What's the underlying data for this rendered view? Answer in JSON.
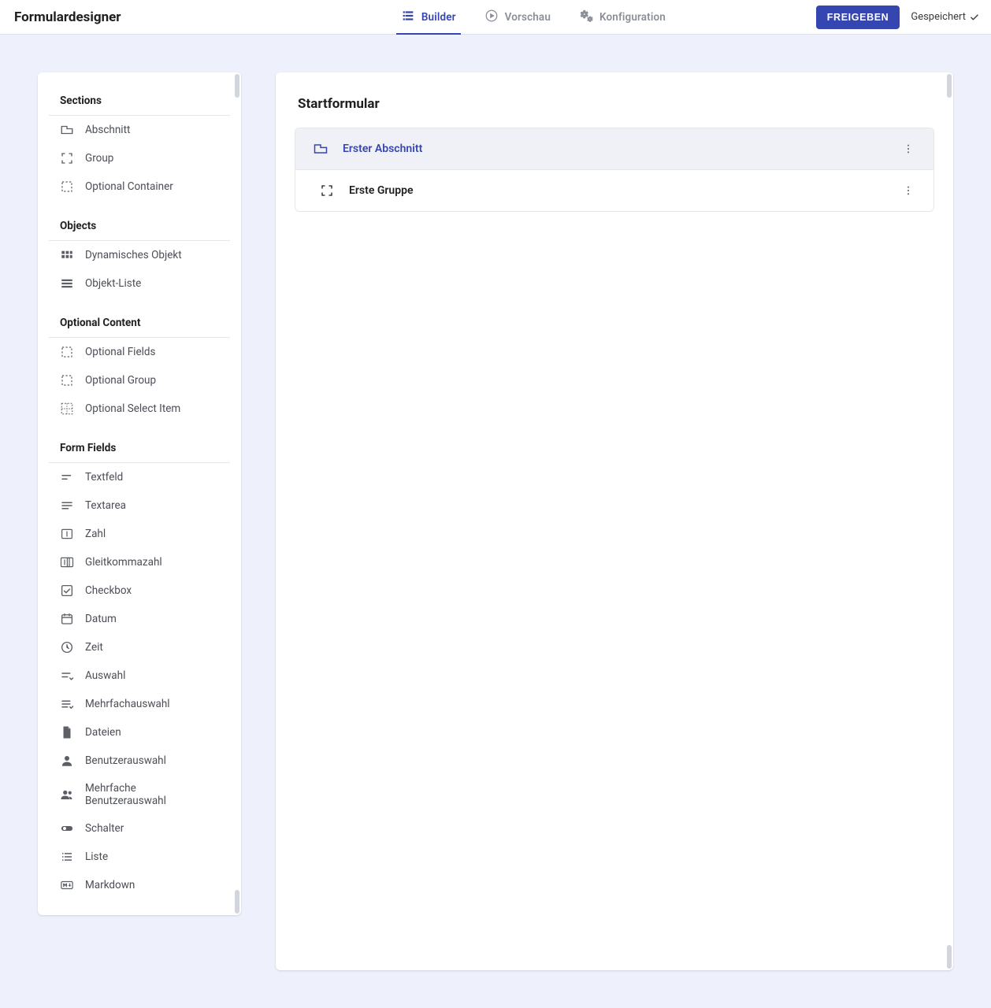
{
  "header": {
    "title": "Formulardesigner",
    "tabs": [
      {
        "id": "builder",
        "label": "Builder"
      },
      {
        "id": "vorschau",
        "label": "Vorschau"
      },
      {
        "id": "konfiguration",
        "label": "Konfiguration"
      }
    ],
    "active_tab": "builder",
    "publish_label": "FREIGEBEN",
    "saved_label": "Gespeichert"
  },
  "palette": {
    "sections": [
      {
        "title": "Sections",
        "items": [
          {
            "id": "abschnitt",
            "label": "Abschnitt",
            "icon": "tab-icon"
          },
          {
            "id": "group",
            "label": "Group",
            "icon": "brackets-icon"
          },
          {
            "id": "optional-container",
            "label": "Optional Container",
            "icon": "dashed-box-icon"
          }
        ]
      },
      {
        "title": "Objects",
        "items": [
          {
            "id": "dyn-object",
            "label": "Dynamisches Objekt",
            "icon": "grid-icon"
          },
          {
            "id": "object-list",
            "label": "Objekt-Liste",
            "icon": "table-rows-icon"
          }
        ]
      },
      {
        "title": "Optional Content",
        "items": [
          {
            "id": "optional-fields",
            "label": "Optional Fields",
            "icon": "dashed-box-icon"
          },
          {
            "id": "optional-group",
            "label": "Optional Group",
            "icon": "dashed-box-icon"
          },
          {
            "id": "optional-select-item",
            "label": "Optional Select Item",
            "icon": "dashed-grid-icon"
          }
        ]
      },
      {
        "title": "Form Fields",
        "items": [
          {
            "id": "textfeld",
            "label": "Textfeld",
            "icon": "short-text-icon"
          },
          {
            "id": "textarea",
            "label": "Textarea",
            "icon": "long-text-icon"
          },
          {
            "id": "zahl",
            "label": "Zahl",
            "icon": "number-box-icon"
          },
          {
            "id": "gleitkommazahl",
            "label": "Gleitkommazahl",
            "icon": "float-box-icon"
          },
          {
            "id": "checkbox",
            "label": "Checkbox",
            "icon": "checkbox-icon"
          },
          {
            "id": "datum",
            "label": "Datum",
            "icon": "calendar-icon"
          },
          {
            "id": "zeit",
            "label": "Zeit",
            "icon": "clock-icon"
          },
          {
            "id": "auswahl",
            "label": "Auswahl",
            "icon": "select-icon"
          },
          {
            "id": "mehrfachauswahl",
            "label": "Mehrfachauswahl",
            "icon": "multiselect-icon"
          },
          {
            "id": "dateien",
            "label": "Dateien",
            "icon": "file-icon"
          },
          {
            "id": "benutzerauswahl",
            "label": "Benutzerauswahl",
            "icon": "person-icon"
          },
          {
            "id": "mehrfache-benutzerauswahl",
            "label": "Mehrfache Benutzerauswahl",
            "icon": "people-icon"
          },
          {
            "id": "schalter",
            "label": "Schalter",
            "icon": "toggle-icon"
          },
          {
            "id": "liste",
            "label": "Liste",
            "icon": "list-icon"
          },
          {
            "id": "markdown",
            "label": "Markdown",
            "icon": "markdown-icon"
          }
        ]
      }
    ]
  },
  "surface": {
    "title": "Startformular",
    "section": {
      "label": "Erster Abschnitt"
    },
    "group": {
      "label": "Erste Gruppe"
    }
  }
}
